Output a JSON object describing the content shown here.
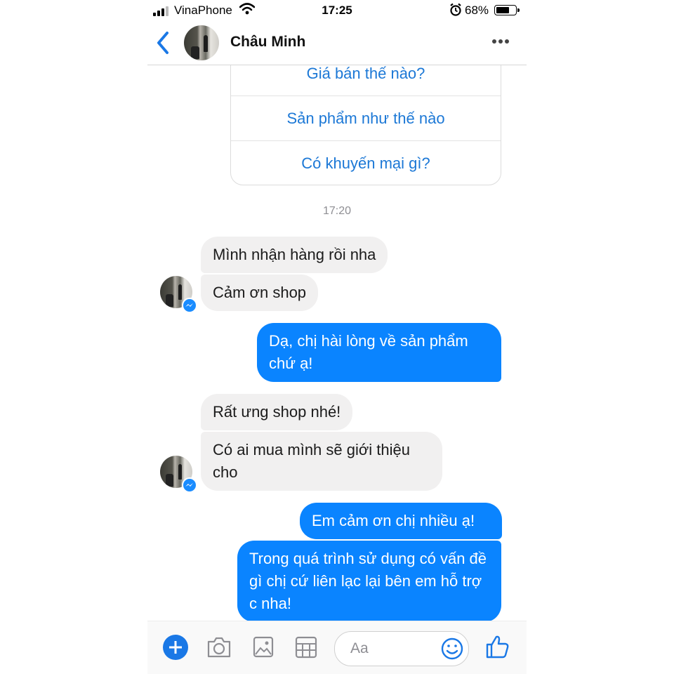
{
  "status_bar": {
    "carrier": "VinaPhone",
    "time": "17:25",
    "battery_percent": "68%",
    "battery_level": 0.68,
    "icons": [
      "signal-icon",
      "wifi-icon",
      "alarm-icon",
      "battery-icon"
    ]
  },
  "header": {
    "contact_name": "Châu Minh",
    "icons": [
      "back-chevron-icon",
      "contact-avatar",
      "more-options-icon"
    ]
  },
  "quick_replies": [
    "Giá bán thế nào?",
    "Sản phẩm như thế nào",
    "Có khuyến mại gì?"
  ],
  "timestamp": "17:20",
  "messages": [
    {
      "from": "contact",
      "text": "Mình nhận hàng rồi nha"
    },
    {
      "from": "contact",
      "text": "Cảm ơn shop"
    },
    {
      "from": "me",
      "text": "Dạ, chị hài lòng về sản phẩm chứ ạ!"
    },
    {
      "from": "contact",
      "text": "Rất ưng shop nhé!"
    },
    {
      "from": "contact",
      "text": "Có ai mua mình sẽ giới thiệu cho"
    },
    {
      "from": "me",
      "text": "Em cảm ơn chị nhiều ạ!"
    },
    {
      "from": "me",
      "text": "Trong quá trình sử dụng có vấn đề gì chị cứ liên lạc lại bên em hỗ trợ c nha!"
    }
  ],
  "composer": {
    "placeholder": "Aa",
    "icons": [
      "plus-icon",
      "camera-icon",
      "photo-icon",
      "sticker-grid-icon",
      "emoji-icon",
      "like-thumb-icon"
    ]
  },
  "colors": {
    "accent_blue": "#0a84ff",
    "link_blue": "#1c78d6",
    "incoming_bubble": "#f1f0f0",
    "timestamp_gray": "#8e8e93"
  }
}
